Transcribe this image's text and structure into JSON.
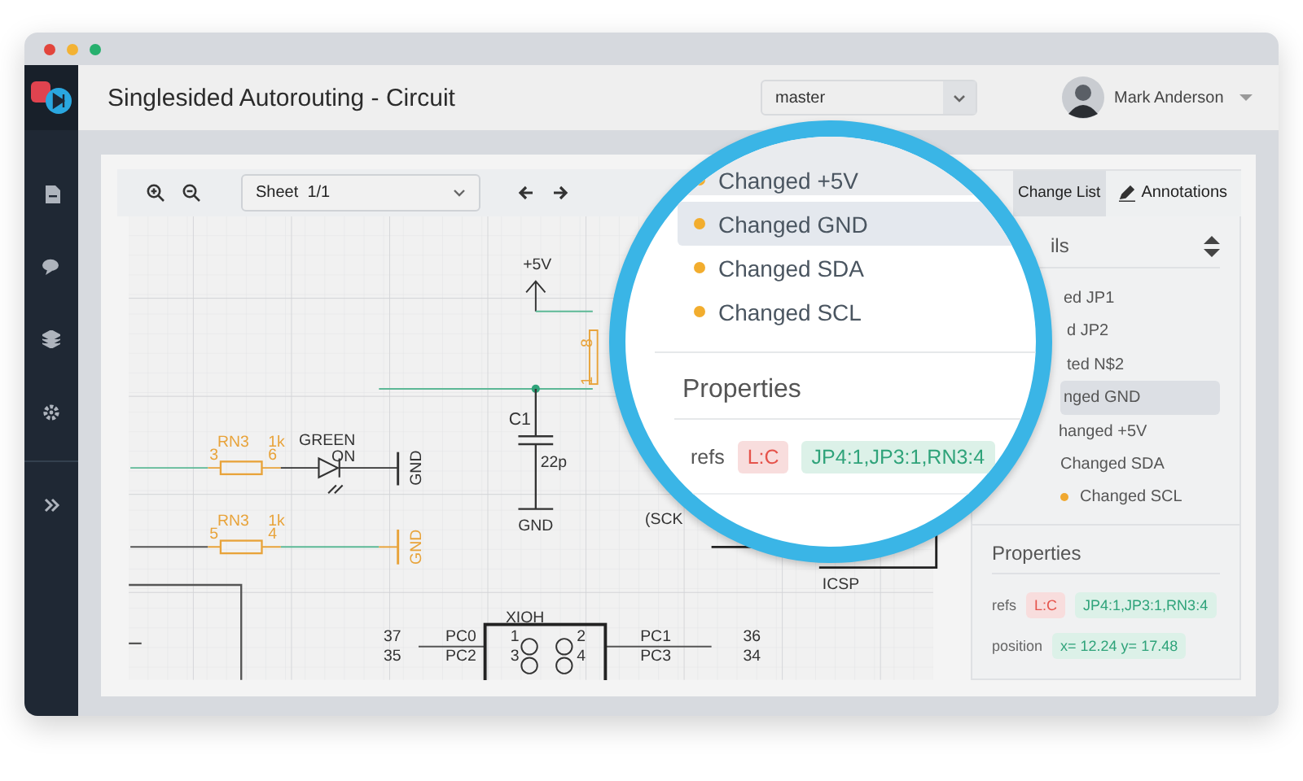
{
  "window": {
    "title": "Singlesided Autorouting - Circuit"
  },
  "header": {
    "branch_select": {
      "value": "master"
    },
    "user": {
      "name": "Mark Anderson"
    }
  },
  "toolbar": {
    "sheet_select": {
      "value": "Sheet  1/1"
    }
  },
  "schematic": {
    "supply": {
      "label": "+5V"
    },
    "header_pins": [
      "8",
      "1"
    ],
    "capacitor": {
      "name": "C1",
      "value": "22p",
      "ground": "GND"
    },
    "resistors": [
      {
        "name": "RN3",
        "value": "1k",
        "pin_a": "3",
        "pin_b": "6"
      },
      {
        "name": "RN3",
        "value": "1k",
        "pin_a": "5",
        "pin_b": "4"
      }
    ],
    "led": {
      "color_label": "GREEN",
      "name": "ON"
    },
    "ground_labels": [
      "GND",
      "GND"
    ],
    "connector": {
      "name": "XIOH",
      "pins": [
        "1",
        "2",
        "3",
        "4"
      ],
      "left_numbers": [
        "37",
        "35"
      ],
      "left_signals": [
        "PC0",
        "PC2"
      ],
      "right_signals": [
        "PC1",
        "PC3"
      ],
      "right_numbers": [
        "36",
        "34"
      ]
    },
    "icsp": {
      "name": "ICSP",
      "signal": "(SCK"
    }
  },
  "panel": {
    "tabs": [
      {
        "label": "Change List",
        "selected": true
      },
      {
        "label": "Annotations",
        "selected": false
      }
    ],
    "details_heading": "ils",
    "changes": [
      {
        "label": "ed JP1",
        "selected": false,
        "marker": false
      },
      {
        "label": "d JP2",
        "selected": false,
        "marker": false
      },
      {
        "label": "ted N$2",
        "selected": false,
        "marker": false
      },
      {
        "label": "nged GND",
        "selected": true,
        "marker": false
      },
      {
        "label": "hanged +5V",
        "selected": false,
        "marker": false
      },
      {
        "label": "Changed SDA",
        "selected": false,
        "marker": false
      },
      {
        "label": "Changed SCL",
        "selected": false,
        "marker": true
      }
    ],
    "properties": {
      "title": "Properties",
      "rows": [
        {
          "key": "refs",
          "tags": [
            {
              "text": "L:C",
              "kind": "removed"
            },
            {
              "text": "JP4:1,JP3:1,RN3:4",
              "kind": "added"
            }
          ]
        },
        {
          "key": "position",
          "tags": [
            {
              "text": "x= 12.24 y= 17.48",
              "kind": "added"
            }
          ]
        }
      ]
    }
  },
  "magnifier": {
    "changes": [
      {
        "label": "Changed +5V",
        "selected": false
      },
      {
        "label": "Changed GND",
        "selected": true
      },
      {
        "label": "Changed SDA",
        "selected": false
      },
      {
        "label": "Changed SCL",
        "selected": false
      }
    ],
    "properties": {
      "title": "Properties",
      "rows": [
        {
          "key": "refs",
          "tags": [
            {
              "text": "L:C",
              "kind": "removed"
            },
            {
              "text": "JP4:1,JP3:1,RN3:4",
              "kind": "added"
            }
          ]
        }
      ]
    }
  }
}
